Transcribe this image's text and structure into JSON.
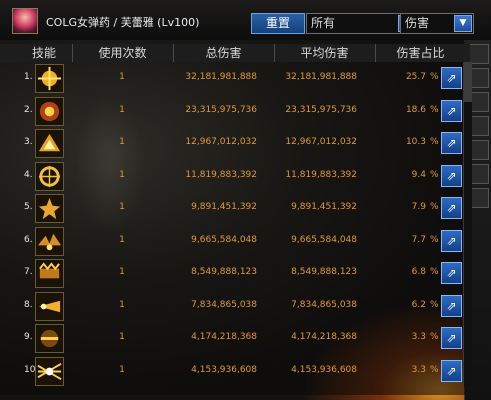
{
  "header": {
    "character": "COLG女弹药 / 芙蕾雅 (Lv100)",
    "reset_label": "重置",
    "filter_selected": "所有",
    "metric_selected": "伤害"
  },
  "columns": {
    "skill": "技能",
    "uses": "使用次数",
    "total": "总伤害",
    "average": "平均伤害",
    "share": "伤害占比"
  },
  "rows": [
    {
      "rank": "1.",
      "uses": "1",
      "total": "32,181,981,888",
      "average": "32,181,981,888",
      "share": "25.7",
      "unit": "%"
    },
    {
      "rank": "2.",
      "uses": "1",
      "total": "23,315,975,736",
      "average": "23,315,975,736",
      "share": "18.6",
      "unit": "%"
    },
    {
      "rank": "3.",
      "uses": "1",
      "total": "12,967,012,032",
      "average": "12,967,012,032",
      "share": "10.3",
      "unit": "%"
    },
    {
      "rank": "4.",
      "uses": "1",
      "total": "11,819,883,392",
      "average": "11,819,883,392",
      "share": "9.4",
      "unit": "%"
    },
    {
      "rank": "5.",
      "uses": "1",
      "total": "9,891,451,392",
      "average": "9,891,451,392",
      "share": "7.9",
      "unit": "%"
    },
    {
      "rank": "6.",
      "uses": "1",
      "total": "9,665,584,048",
      "average": "9,665,584,048",
      "share": "7.7",
      "unit": "%"
    },
    {
      "rank": "7.",
      "uses": "1",
      "total": "8,549,888,123",
      "average": "8,549,888,123",
      "share": "6.8",
      "unit": "%"
    },
    {
      "rank": "8.",
      "uses": "1",
      "total": "7,834,865,038",
      "average": "7,834,865,038",
      "share": "6.2",
      "unit": "%"
    },
    {
      "rank": "9.",
      "uses": "1",
      "total": "4,174,218,368",
      "average": "4,174,218,368",
      "share": "3.3",
      "unit": "%"
    },
    {
      "rank": "10.",
      "uses": "1",
      "total": "4,153,936,608",
      "average": "4,153,936,608",
      "share": "3.3",
      "unit": "%"
    }
  ],
  "icons": {
    "skill": "skill-icon",
    "export": "export-icon",
    "dropdown": "chevron-down-icon"
  },
  "colors": {
    "value_text": "#e09a35",
    "header_text": "#d8d8d8",
    "accent_blue": "#2a62a6"
  }
}
